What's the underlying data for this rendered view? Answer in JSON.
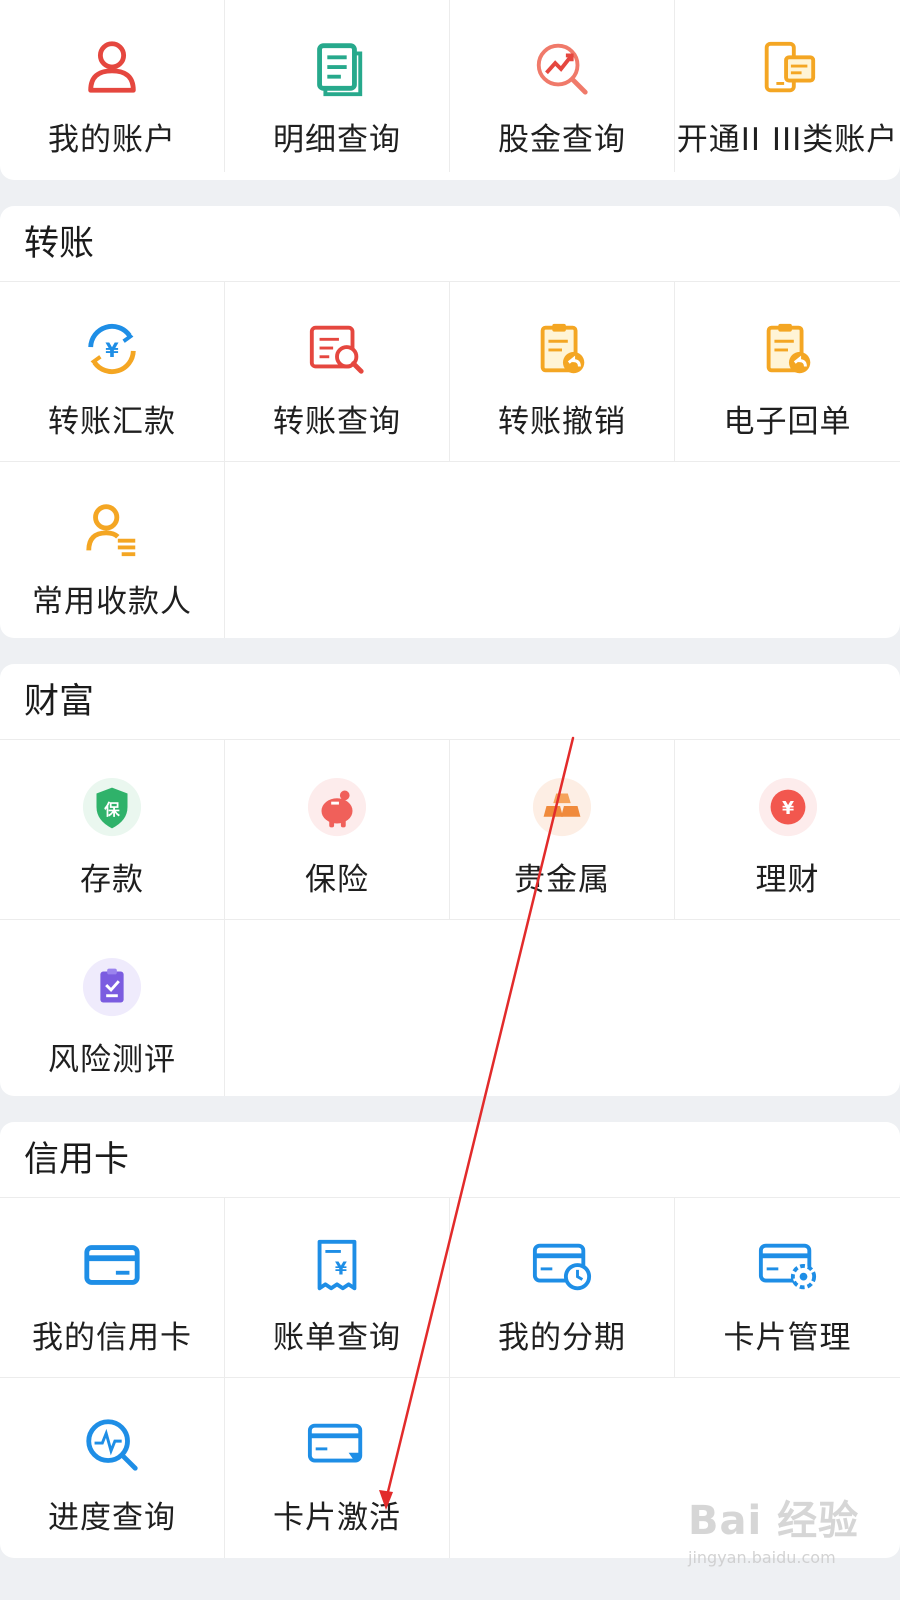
{
  "accounts": {
    "items": [
      {
        "label": "我的账户",
        "icon": "user-icon"
      },
      {
        "label": "明细查询",
        "icon": "document-list-icon"
      },
      {
        "label": "股金查询",
        "icon": "trend-search-icon"
      },
      {
        "label": "开通II III类账户",
        "icon": "phone-card-icon"
      }
    ]
  },
  "transfer": {
    "title": "转账",
    "items": [
      {
        "label": "转账汇款",
        "icon": "yuan-exchange-icon"
      },
      {
        "label": "转账查询",
        "icon": "receipt-search-icon"
      },
      {
        "label": "转账撤销",
        "icon": "clipboard-undo-icon"
      },
      {
        "label": "电子回单",
        "icon": "clipboard-undo-icon"
      },
      {
        "label": "常用收款人",
        "icon": "contact-list-icon"
      }
    ]
  },
  "wealth": {
    "title": "财富",
    "items": [
      {
        "label": "存款",
        "icon": "shield-deposit-icon",
        "badge": "保"
      },
      {
        "label": "保险",
        "icon": "piggy-bank-icon"
      },
      {
        "label": "贵金属",
        "icon": "gold-bars-icon"
      },
      {
        "label": "理财",
        "icon": "yuan-coin-icon",
        "badge": "¥"
      },
      {
        "label": "风险测评",
        "icon": "clipboard-check-icon"
      }
    ]
  },
  "credit": {
    "title": "信用卡",
    "items": [
      {
        "label": "我的信用卡",
        "icon": "credit-card-icon"
      },
      {
        "label": "账单查询",
        "icon": "bill-icon"
      },
      {
        "label": "我的分期",
        "icon": "card-clock-icon"
      },
      {
        "label": "卡片管理",
        "icon": "card-gear-icon"
      },
      {
        "label": "进度查询",
        "icon": "pulse-search-icon"
      },
      {
        "label": "卡片激活",
        "icon": "card-activate-icon"
      }
    ]
  },
  "colors": {
    "red": "#e5473f",
    "teal": "#27a98c",
    "orange": "#f4a623",
    "blue": "#1e8ee6",
    "purple": "#7b5ce0",
    "annotation": "#e22b2b"
  },
  "watermark": {
    "main": "Bai 经验",
    "sub": "jingyan.baidu.com"
  }
}
